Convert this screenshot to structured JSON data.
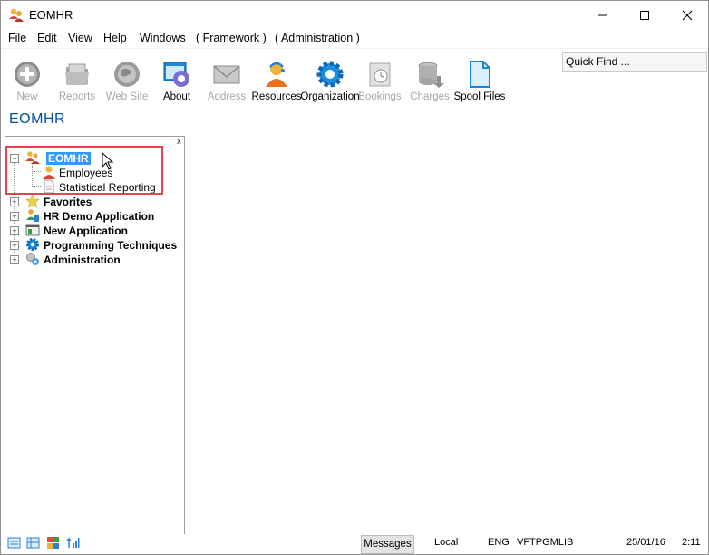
{
  "window": {
    "title": "EOMHR",
    "minimize": "—",
    "maximize": "☐",
    "close": "✕"
  },
  "menu": [
    "File",
    "Edit",
    "View",
    "Help",
    "Windows",
    "( Framework )",
    "( Administration )"
  ],
  "toolbar": [
    {
      "label": "New",
      "icon": "new-icon",
      "enabled": false
    },
    {
      "label": "Reports",
      "icon": "reports-icon",
      "enabled": false
    },
    {
      "label": "Web Site",
      "icon": "globe-icon",
      "enabled": false
    },
    {
      "label": "About",
      "icon": "about-icon",
      "enabled": true
    },
    {
      "label": "Address",
      "icon": "envelope-icon",
      "enabled": false
    },
    {
      "label": "Resources",
      "icon": "person-icon",
      "enabled": true
    },
    {
      "label": "Organization",
      "icon": "gear-icon",
      "enabled": true
    },
    {
      "label": "Bookings",
      "icon": "clock-icon",
      "enabled": false
    },
    {
      "label": "Charges",
      "icon": "database-icon",
      "enabled": false
    },
    {
      "label": "Spool Files",
      "icon": "document-icon",
      "enabled": true
    }
  ],
  "quick_find": {
    "placeholder": "Quick Find ..."
  },
  "page_title": "EOMHR",
  "tree": {
    "close": "x",
    "root": {
      "label": "EOMHR",
      "expanded": true,
      "selected": true,
      "children": [
        {
          "label": "Employees",
          "icon": "person-icon"
        },
        {
          "label": "Statistical Reporting",
          "icon": "document-icon"
        }
      ]
    },
    "nodes": [
      {
        "label": "Favorites",
        "icon": "star-icon"
      },
      {
        "label": "HR Demo Application",
        "icon": "people-icon"
      },
      {
        "label": "New Application",
        "icon": "window-icon"
      },
      {
        "label": "Programming Techniques",
        "icon": "gear-icon"
      },
      {
        "label": "Administration",
        "icon": "admin-icon"
      }
    ]
  },
  "status": {
    "messages_button": "Messages",
    "location": "Local",
    "language": "ENG",
    "library": "VFTPGMLIB",
    "date": "25/01/16",
    "time": "2:11"
  }
}
